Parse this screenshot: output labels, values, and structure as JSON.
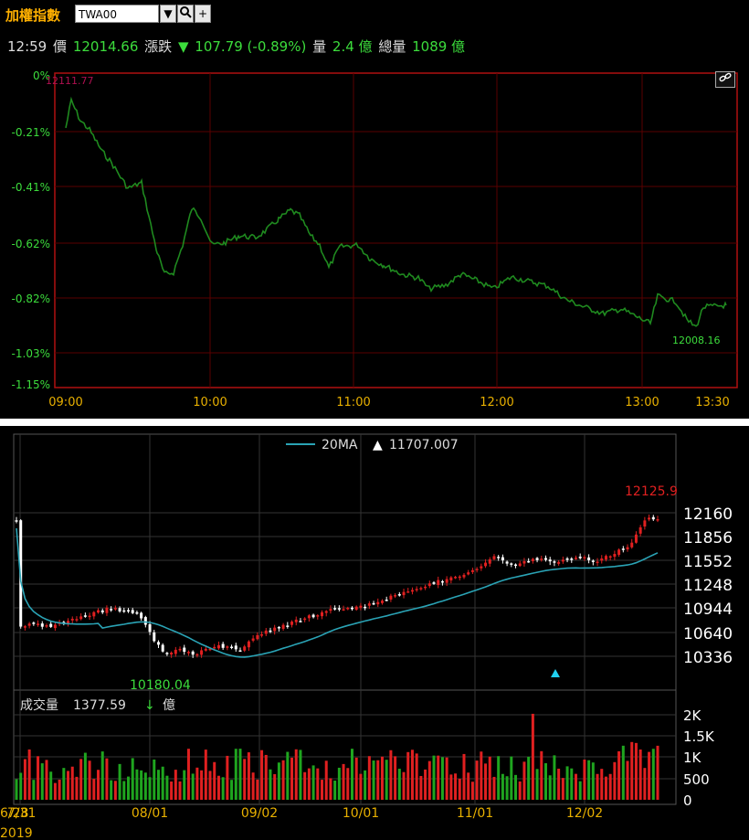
{
  "header": {
    "index_name": "加權指數",
    "symbol": "TWA00",
    "dropdown_icon": "▼",
    "search_icon": "🔍",
    "add_icon": "+"
  },
  "quote": {
    "time": "12:59",
    "price_label": "價",
    "price": "12014.66",
    "change_label": "漲跌",
    "change_arrow": "▼",
    "change": "107.79 (-0.89%)",
    "volume_label": "量",
    "volume": "2.4 億",
    "total_volume_label": "總量",
    "total_volume": "1089 億"
  },
  "intraday": {
    "ref_label": "12111.77",
    "last_label": "12008.16",
    "y_ticks": [
      "0%",
      "-0.21%",
      "-0.41%",
      "-0.62%",
      "-0.82%",
      "-1.03%",
      "-1.15%"
    ],
    "x_ticks": [
      "09:00",
      "10:00",
      "11:00",
      "12:00",
      "13:00",
      "13:30"
    ],
    "link_icon": "link-icon"
  },
  "daily": {
    "ma_label": "20MA",
    "ma_arrow": "▲",
    "ma_value": "11707.007",
    "high_label": "12125.9",
    "low_label": "10180.04",
    "y_ticks": [
      "12160",
      "11856",
      "11552",
      "11248",
      "10944",
      "10640",
      "10336"
    ],
    "volume_label": "成交量",
    "volume_value": "1377.59",
    "volume_arrow": "↓",
    "volume_unit": "億",
    "vol_ticks": [
      "2K",
      "1.5K",
      "1K",
      "500",
      "0"
    ],
    "x_ticks": [
      "6/28",
      "08/01",
      "09/02",
      "10/01",
      "11/01",
      "12/02"
    ],
    "x_sub": "2019",
    "overlap_label": "7/31"
  },
  "colors": {
    "up": "#e02020",
    "down": "#ffffff",
    "line": "#1f8a1f",
    "ma": "#2aa3b5",
    "grid": "#5a0000",
    "accent": "#ffb000",
    "green_text": "#3cdc3c"
  }
}
